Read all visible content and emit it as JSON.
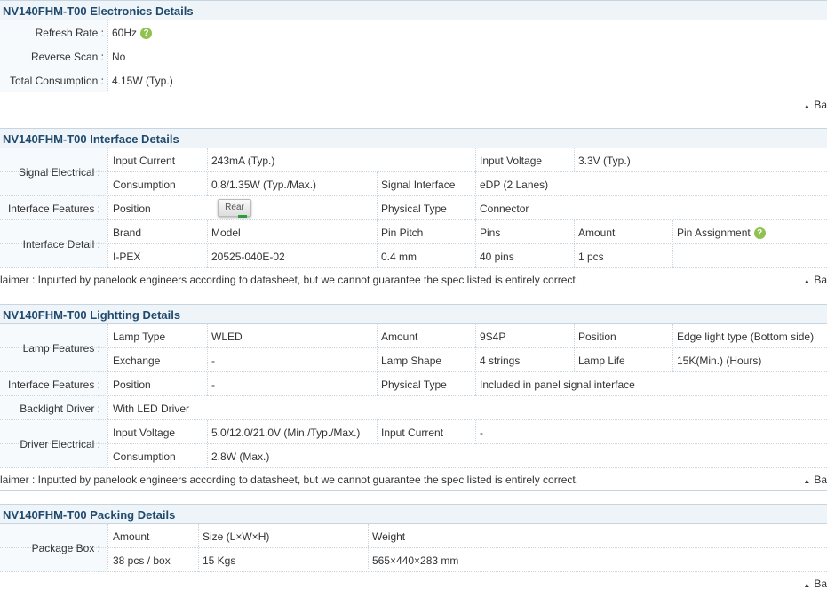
{
  "electronics": {
    "title": "NV140FHM-T00 Electronics Details",
    "refresh_label": "Refresh Rate :",
    "refresh_value": "60Hz",
    "reverse_label": "Reverse Scan :",
    "reverse_value": "No",
    "consumption_label": "Total Consumption :",
    "consumption_value": "4.15W (Typ.)",
    "back": "Ba"
  },
  "interface": {
    "title": "NV140FHM-T00 Interface Details",
    "signal_label": "Signal Electrical :",
    "input_current_k": "Input Current",
    "input_current_v": "243mA (Typ.)",
    "input_voltage_k": "Input Voltage",
    "input_voltage_v": "3.3V (Typ.)",
    "consumption_k": "Consumption",
    "consumption_v": "0.8/1.35W (Typ./Max.)",
    "signal_interface_k": "Signal Interface",
    "signal_interface_v": "eDP (2 Lanes)",
    "features_label": "Interface Features :",
    "position_k": "Position",
    "position_btn": "Rear",
    "physical_k": "Physical Type",
    "physical_v": "Connector",
    "detail_label": "Interface Detail :",
    "headers": [
      "Brand",
      "Model",
      "Pin Pitch",
      "Pins",
      "Amount",
      "Pin Assignment"
    ],
    "values": [
      "I-PEX",
      "20525-040E-02",
      "0.4 mm",
      "40 pins",
      "1 pcs"
    ],
    "disclaimer": "laimer : Inputted by panelook engineers according to datasheet, but we cannot guarantee the spec listed is entirely correct.",
    "back": "Ba"
  },
  "lighting": {
    "title": "NV140FHM-T00 Lightting Details",
    "lamp_label": "Lamp Features :",
    "lamp_type_k": "Lamp Type",
    "lamp_type_v": "WLED",
    "amount_k": "Amount",
    "amount_v": "9S4P",
    "position_k": "Position",
    "position_v": "Edge light type (Bottom side)",
    "exchange_k": "Exchange",
    "exchange_v": "-",
    "shape_k": "Lamp Shape",
    "shape_v": "4 strings",
    "life_k": "Lamp Life",
    "life_v": "15K(Min.) (Hours)",
    "features_label": "Interface Features :",
    "if_position_k": "Position",
    "if_position_v": "-",
    "physical_k": "Physical Type",
    "physical_v": "Included in panel signal interface",
    "driver_label": "Backlight Driver :",
    "driver_v": "With LED Driver",
    "driver_elec_label": "Driver Electrical :",
    "input_voltage_k": "Input Voltage",
    "input_voltage_v": "5.0/12.0/21.0V (Min./Typ./Max.)",
    "input_current_k": "Input Current",
    "input_current_v": "-",
    "consumption_k": "Consumption",
    "consumption_v": "2.8W (Max.)",
    "disclaimer": "laimer : Inputted by panelook engineers according to datasheet, but we cannot guarantee the spec listed is entirely correct.",
    "back": "Ba"
  },
  "packing": {
    "title": "NV140FHM-T00 Packing Details",
    "box_label": "Package Box :",
    "headers": [
      "Amount",
      "Size (L×W×H)",
      "Weight"
    ],
    "values": [
      "38 pcs / box",
      "15 Kgs",
      "565×440×283 mm"
    ],
    "back": "Ba"
  },
  "icons": {
    "help": "?",
    "up": "▲"
  }
}
